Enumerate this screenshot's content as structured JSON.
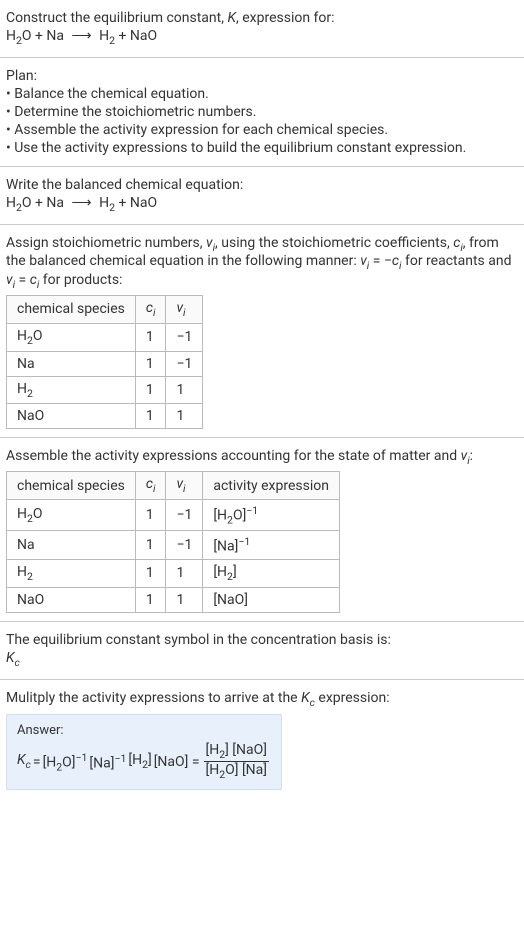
{
  "header": {
    "construct_line_prefix": "Construct the equilibrium constant, ",
    "K": "K",
    "construct_line_suffix": ", expression for:",
    "equation_lhs1": "H",
    "equation_lhs1_sub": "2",
    "equation_lhs1_tail": "O + Na",
    "arrow": "⟶",
    "equation_rhs1": "H",
    "equation_rhs1_sub": "2",
    "equation_rhs_tail": " + NaO"
  },
  "plan": {
    "title": "Plan:",
    "items": [
      "• Balance the chemical equation.",
      "• Determine the stoichiometric numbers.",
      "• Assemble the activity expression for each chemical species.",
      "• Use the activity expressions to build the equilibrium constant expression."
    ]
  },
  "balanced": {
    "title": "Write the balanced chemical equation:",
    "equation_lhs1": "H",
    "equation_lhs1_sub": "2",
    "equation_lhs1_tail": "O + Na",
    "arrow": "⟶",
    "equation_rhs1": "H",
    "equation_rhs1_sub": "2",
    "equation_rhs_tail": " + NaO"
  },
  "stoich": {
    "intro_1": "Assign stoichiometric numbers, ",
    "nu_i": "ν",
    "nu_i_sub": "i",
    "intro_2": ", using the stoichiometric coefficients, ",
    "c_i": "c",
    "c_i_sub": "i",
    "intro_3": ", from the balanced chemical equation in the following manner: ",
    "nu_eq_neg_c": "ν",
    "eq_text1": " = −",
    "intro_4": " for reactants and ",
    "eq_text2": " = ",
    "intro_5": " for products:",
    "headers": {
      "species": "chemical species",
      "ci": "c",
      "ci_sub": "i",
      "nui": "ν",
      "nui_sub": "i"
    },
    "rows": [
      {
        "species_h": "H",
        "species_sub": "2",
        "species_tail": "O",
        "ci": "1",
        "nui": "−1"
      },
      {
        "species_h": "Na",
        "species_sub": "",
        "species_tail": "",
        "ci": "1",
        "nui": "−1"
      },
      {
        "species_h": "H",
        "species_sub": "2",
        "species_tail": "",
        "ci": "1",
        "nui": "1"
      },
      {
        "species_h": "NaO",
        "species_sub": "",
        "species_tail": "",
        "ci": "1",
        "nui": "1"
      }
    ]
  },
  "activity": {
    "title_1": "Assemble the activity expressions accounting for the state of matter and ",
    "nu": "ν",
    "nu_sub": "i",
    "title_2": ":",
    "headers": {
      "species": "chemical species",
      "ci": "c",
      "ci_sub": "i",
      "nui": "ν",
      "nui_sub": "i",
      "act": "activity expression"
    },
    "rows": [
      {
        "species_h": "H",
        "species_sub": "2",
        "species_tail": "O",
        "ci": "1",
        "nui": "−1",
        "act_pre": "[H",
        "act_sub": "2",
        "act_mid": "O]",
        "act_sup": "−1"
      },
      {
        "species_h": "Na",
        "species_sub": "",
        "species_tail": "",
        "ci": "1",
        "nui": "−1",
        "act_pre": "[Na]",
        "act_sub": "",
        "act_mid": "",
        "act_sup": "−1"
      },
      {
        "species_h": "H",
        "species_sub": "2",
        "species_tail": "",
        "ci": "1",
        "nui": "1",
        "act_pre": "[H",
        "act_sub": "2",
        "act_mid": "]",
        "act_sup": ""
      },
      {
        "species_h": "NaO",
        "species_sub": "",
        "species_tail": "",
        "ci": "1",
        "nui": "1",
        "act_pre": "[NaO]",
        "act_sub": "",
        "act_mid": "",
        "act_sup": ""
      }
    ]
  },
  "symbol": {
    "line": "The equilibrium constant symbol in the concentration basis is:",
    "K": "K",
    "K_sub": "c"
  },
  "multiply": {
    "line_1": "Mulitply the activity expressions to arrive at the ",
    "K": "K",
    "K_sub": "c",
    "line_2": " expression:"
  },
  "answer": {
    "label": "Answer:",
    "Kc": "K",
    "Kc_sub": "c",
    "eq": " = ",
    "t1": "[H",
    "t1_sub": "2",
    "t1_tail": "O]",
    "t1_sup": "−1",
    "t2": " [Na]",
    "t2_sup": "−1",
    "t3": " [H",
    "t3_sub": "2",
    "t3_tail": "]",
    "t4": " [NaO] = ",
    "num_1": "[H",
    "num_1_sub": "2",
    "num_1_tail": "] [NaO]",
    "den_1": "[H",
    "den_1_sub": "2",
    "den_1_tail": "O] [Na]"
  }
}
